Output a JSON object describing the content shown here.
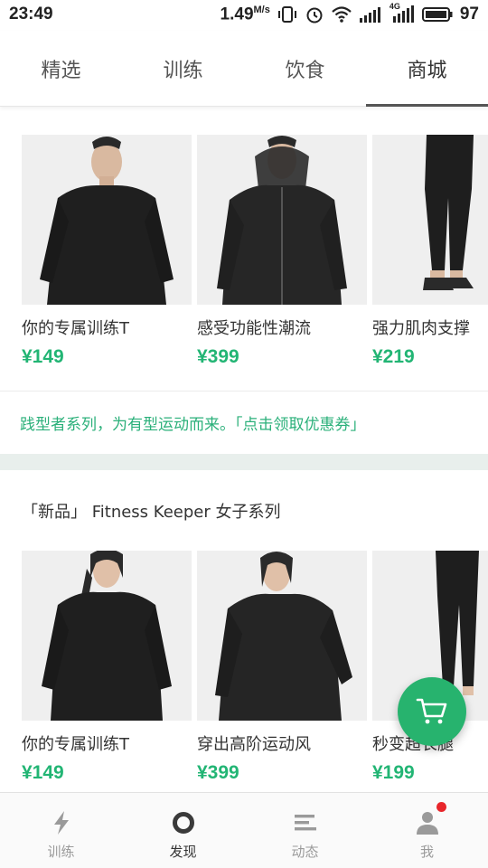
{
  "status_bar": {
    "time": "23:49",
    "speed_value": "1.49",
    "speed_unit": "M/s",
    "battery": "97",
    "network_label": "4G"
  },
  "top_tabs": [
    {
      "label": "精选",
      "active": false
    },
    {
      "label": "训练",
      "active": false
    },
    {
      "label": "饮食",
      "active": false
    },
    {
      "label": "商城",
      "active": true
    }
  ],
  "row1": {
    "products": [
      {
        "name": "你的专属训练T",
        "price": "¥149"
      },
      {
        "name": "感受功能性潮流",
        "price": "¥399"
      },
      {
        "name": "强力肌肉支撑",
        "price": "¥219"
      }
    ]
  },
  "promo_text": "践型者系列，为有型运动而来。「点击领取优惠券」",
  "section_title": "「新品」 Fitness Keeper 女子系列",
  "row2": {
    "products": [
      {
        "name": "你的专属训练T",
        "price": "¥149"
      },
      {
        "name": "穿出高阶运动风",
        "price": "¥399"
      },
      {
        "name": "秒变超长腿",
        "price": "¥199"
      }
    ]
  },
  "bottom_nav": [
    {
      "label": "训练",
      "icon": "lightning-icon",
      "active": false
    },
    {
      "label": "发现",
      "icon": "discover-ring-icon",
      "active": true
    },
    {
      "label": "动态",
      "icon": "feed-lines-icon",
      "active": false
    },
    {
      "label": "我",
      "icon": "user-icon",
      "active": false,
      "badge": true
    }
  ],
  "colors": {
    "accent": "#27b36e",
    "price": "#22b574",
    "promo": "#2bb07a",
    "badge": "#e8262b"
  }
}
